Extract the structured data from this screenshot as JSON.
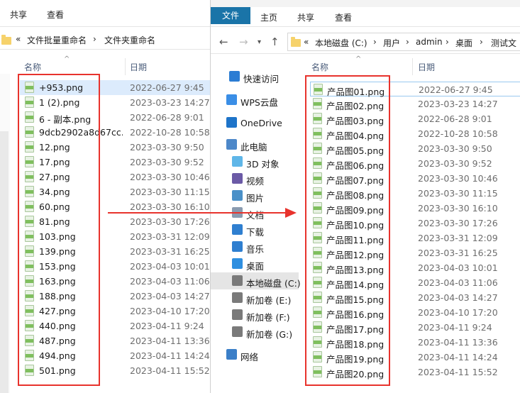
{
  "left_window": {
    "ribbon_tabs": [
      "共享",
      "查看"
    ],
    "breadcrumb": [
      "«",
      "文件批量重命名",
      "›",
      "文件夹重命名"
    ],
    "columns": {
      "name": "名称",
      "date": "日期"
    },
    "files": [
      {
        "name": "+953.png",
        "date": "2022-06-27 9:45"
      },
      {
        "name": "1 (2).png",
        "date": "2023-03-23 14:27"
      },
      {
        "name": "6 - 副本.png",
        "date": "2022-06-28 9:01"
      },
      {
        "name": "9dcb2902a8d67cc...",
        "date": "2022-10-28 10:58"
      },
      {
        "name": "12.png",
        "date": "2023-03-30 9:50"
      },
      {
        "name": "17.png",
        "date": "2023-03-30 9:52"
      },
      {
        "name": "27.png",
        "date": "2023-03-30 10:46"
      },
      {
        "name": "34.png",
        "date": "2023-03-30 11:15"
      },
      {
        "name": "60.png",
        "date": "2023-03-30 16:10"
      },
      {
        "name": "81.png",
        "date": "2023-03-30 17:26"
      },
      {
        "name": "103.png",
        "date": "2023-03-31 12:09"
      },
      {
        "name": "139.png",
        "date": "2023-03-31 16:25"
      },
      {
        "name": "153.png",
        "date": "2023-04-03 10:01"
      },
      {
        "name": "163.png",
        "date": "2023-04-03 11:06"
      },
      {
        "name": "188.png",
        "date": "2023-04-03 14:27"
      },
      {
        "name": "427.png",
        "date": "2023-04-10 17:20"
      },
      {
        "name": "440.png",
        "date": "2023-04-11 9:24"
      },
      {
        "name": "487.png",
        "date": "2023-04-11 13:36"
      },
      {
        "name": "494.png",
        "date": "2023-04-11 14:24"
      },
      {
        "name": "501.png",
        "date": "2023-04-11 15:52"
      }
    ]
  },
  "right_window": {
    "ribbon_tabs": {
      "file": "文件",
      "home": "主页",
      "share": "共享",
      "view": "查看"
    },
    "breadcrumb": [
      "«",
      "本地磁盘 (C:)",
      "›",
      "用户",
      "›",
      "admin",
      "›",
      "桌面",
      "›",
      "测试文"
    ],
    "nav_pane": [
      {
        "label": "快速访问",
        "icon": "star-icon"
      },
      {
        "label": "WPS云盘",
        "icon": "cloud-icon"
      },
      {
        "label": "OneDrive",
        "icon": "onedrive-icon"
      },
      {
        "label": "此电脑",
        "icon": "computer-icon"
      },
      {
        "label": "3D 对象",
        "icon": "cube-icon"
      },
      {
        "label": "视频",
        "icon": "video-icon"
      },
      {
        "label": "图片",
        "icon": "picture-icon"
      },
      {
        "label": "文档",
        "icon": "document-icon"
      },
      {
        "label": "下载",
        "icon": "download-icon"
      },
      {
        "label": "音乐",
        "icon": "music-icon"
      },
      {
        "label": "桌面",
        "icon": "desktop-icon"
      },
      {
        "label": "本地磁盘 (C:)",
        "icon": "drive-icon"
      },
      {
        "label": "新加卷 (E:)",
        "icon": "drive-icon"
      },
      {
        "label": "新加卷 (F:)",
        "icon": "drive-icon"
      },
      {
        "label": "新加卷 (G:)",
        "icon": "drive-icon"
      },
      {
        "label": "网络",
        "icon": "network-icon"
      }
    ],
    "columns": {
      "name": "名称",
      "date": "日期"
    },
    "files": [
      {
        "name": "产品图01.png",
        "date": "2022-06-27 9:45"
      },
      {
        "name": "产品图02.png",
        "date": "2023-03-23 14:27"
      },
      {
        "name": "产品图03.png",
        "date": "2022-06-28 9:01"
      },
      {
        "name": "产品图04.png",
        "date": "2022-10-28 10:58"
      },
      {
        "name": "产品图05.png",
        "date": "2023-03-30 9:50"
      },
      {
        "name": "产品图06.png",
        "date": "2023-03-30 9:52"
      },
      {
        "name": "产品图07.png",
        "date": "2023-03-30 10:46"
      },
      {
        "name": "产品图08.png",
        "date": "2023-03-30 11:15"
      },
      {
        "name": "产品图09.png",
        "date": "2023-03-30 16:10"
      },
      {
        "name": "产品图10.png",
        "date": "2023-03-30 17:26"
      },
      {
        "name": "产品图11.png",
        "date": "2023-03-31 12:09"
      },
      {
        "name": "产品图12.png",
        "date": "2023-03-31 16:25"
      },
      {
        "name": "产品图13.png",
        "date": "2023-04-03 10:01"
      },
      {
        "name": "产品图14.png",
        "date": "2023-04-03 11:06"
      },
      {
        "name": "产品图15.png",
        "date": "2023-04-03 14:27"
      },
      {
        "name": "产品图16.png",
        "date": "2023-04-10 17:20"
      },
      {
        "name": "产品图17.png",
        "date": "2023-04-11 9:24"
      },
      {
        "name": "产品图18.png",
        "date": "2023-04-11 13:36"
      },
      {
        "name": "产品图19.png",
        "date": "2023-04-11 14:24"
      },
      {
        "name": "产品图20.png",
        "date": "2023-04-11 15:52"
      }
    ]
  },
  "annotation_color": "#e8332d"
}
